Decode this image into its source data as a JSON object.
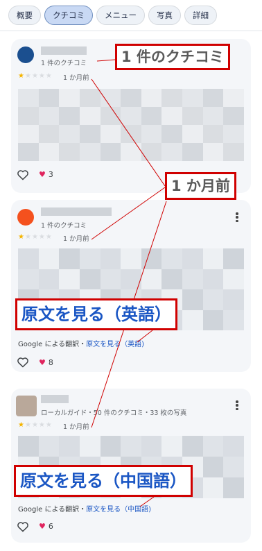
{
  "tabs": [
    "概要",
    "クチコミ",
    "メニュー",
    "写真",
    "詳細"
  ],
  "active_tab": "クチコミ",
  "reviews": [
    {
      "reviewer_meta": "1 件のクチコミ",
      "rating": 1,
      "date": "1 か月前",
      "likes": "3",
      "translate": null
    },
    {
      "reviewer_meta": "1 件のクチコミ",
      "rating": 1,
      "date": "1 か月前",
      "likes": "8",
      "translate": {
        "prefix": "Google による翻訳・",
        "link": "原文を見る（英語)"
      }
    },
    {
      "reviewer_meta": "ローカルガイド・50 件のクチコミ・33 枚の写真",
      "rating": 1,
      "date": "1 か月前",
      "likes": "6",
      "translate": {
        "prefix": "Google による翻訳・",
        "link": "原文を見る（中国語)"
      }
    }
  ],
  "callouts": {
    "review_count": "1 件のクチコミ",
    "date": "1 か月前",
    "original_english": "原文を見る（英語）",
    "original_chinese": "原文を見る（中国語）"
  },
  "colors": {
    "annotation_red": "#d00000",
    "link_blue": "#1a56c4",
    "star_gold": "#f5b400",
    "heart_pink": "#e0245e"
  }
}
